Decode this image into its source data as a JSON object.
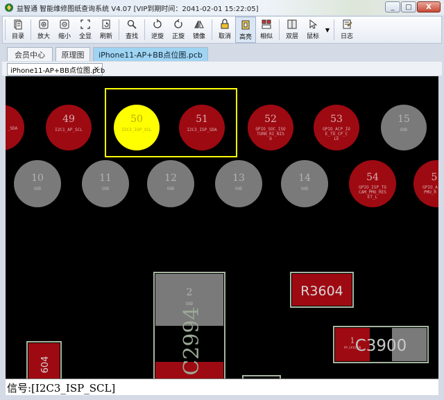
{
  "window": {
    "title": "益智通 智能维修图纸查询系统 V4.07 [VIP到期时间：2041-02-01 15:22:05]",
    "controls": {
      "minimize": "_",
      "maximize": "□",
      "close": "X"
    }
  },
  "toolbar": {
    "buttons": [
      {
        "label": "目录",
        "icon": "catalog-icon"
      },
      {
        "label": "放大",
        "icon": "zoom-in-icon"
      },
      {
        "label": "缩小",
        "icon": "zoom-out-icon"
      },
      {
        "label": "全显",
        "icon": "fit-all-icon"
      },
      {
        "label": "刷新",
        "icon": "refresh-icon"
      },
      {
        "label": "查找",
        "icon": "search-icon"
      },
      {
        "label": "逆旋",
        "icon": "rotate-ccw-icon"
      },
      {
        "label": "正旋",
        "icon": "rotate-cw-icon"
      },
      {
        "label": "镜像",
        "icon": "mirror-icon"
      },
      {
        "label": "取消",
        "icon": "cancel-icon"
      },
      {
        "label": "高亮",
        "icon": "highlight-icon"
      },
      {
        "label": "相似",
        "icon": "similar-icon"
      },
      {
        "label": "双层",
        "icon": "dual-layer-icon"
      },
      {
        "label": "鼠标",
        "icon": "mouse-pointer-icon"
      },
      {
        "label": "日志",
        "icon": "log-icon"
      }
    ]
  },
  "tabs": [
    {
      "label": "会员中心"
    },
    {
      "label": "原理图"
    },
    {
      "label": "iPhone11-AP+BB点位图.pcb",
      "selected": true
    }
  ],
  "document_tab": {
    "label": "iPhone11-AP+BB点位图.pcb",
    "close": "×"
  },
  "pcb": {
    "pads_row1": [
      {
        "num": "",
        "net": "_SDA",
        "color": "#9e0a12"
      },
      {
        "num": "49",
        "net": "I2C1_AP_SCL",
        "color": "#9e0a12"
      },
      {
        "num": "50",
        "net": "I2C3_ISP_SCL",
        "color": "#ffff00",
        "highlight": true
      },
      {
        "num": "51",
        "net": "I2C3_ISP_SDA",
        "color": "#9e0a12"
      },
      {
        "num": "52",
        "net": "GPIO_SOC_ISO\nTURN_RI_NIS\nO",
        "color": "#9e0a12"
      },
      {
        "num": "53",
        "net": "GPIO_ACP_IO\nE_TO_CP_C\nLE",
        "color": "#9e0a12"
      },
      {
        "num": "15",
        "net": "GND",
        "color": "#7a7a7a"
      }
    ],
    "pads_row2": [
      {
        "num": "10",
        "net": "GND",
        "color": "#7a7a7a"
      },
      {
        "num": "11",
        "net": "GND",
        "color": "#7a7a7a"
      },
      {
        "num": "12",
        "net": "GND",
        "color": "#7a7a7a"
      },
      {
        "num": "13",
        "net": "GND",
        "color": "#7a7a7a"
      },
      {
        "num": "14",
        "net": "GND",
        "color": "#7a7a7a"
      },
      {
        "num": "54",
        "net": "GPIO_ISP_TO\nCAM_PMU_RES\nET_L",
        "color": "#9e0a12"
      },
      {
        "num": "5",
        "net": "GPIO_A\nPMU_R",
        "color": "#9e0a12"
      }
    ],
    "components": {
      "c2994": {
        "ref": "C2994",
        "pad_num": "2",
        "pad_net": "GND"
      },
      "r3604": {
        "ref": "R3604"
      },
      "c3900": {
        "ref": "C3900",
        "pad_num": "1",
        "pad_net": "PP_GPIO_ON"
      },
      "left_part": {
        "ref": "604"
      }
    }
  },
  "status": {
    "signal_label": "信号:[I2C3_ISP_SCL]"
  }
}
